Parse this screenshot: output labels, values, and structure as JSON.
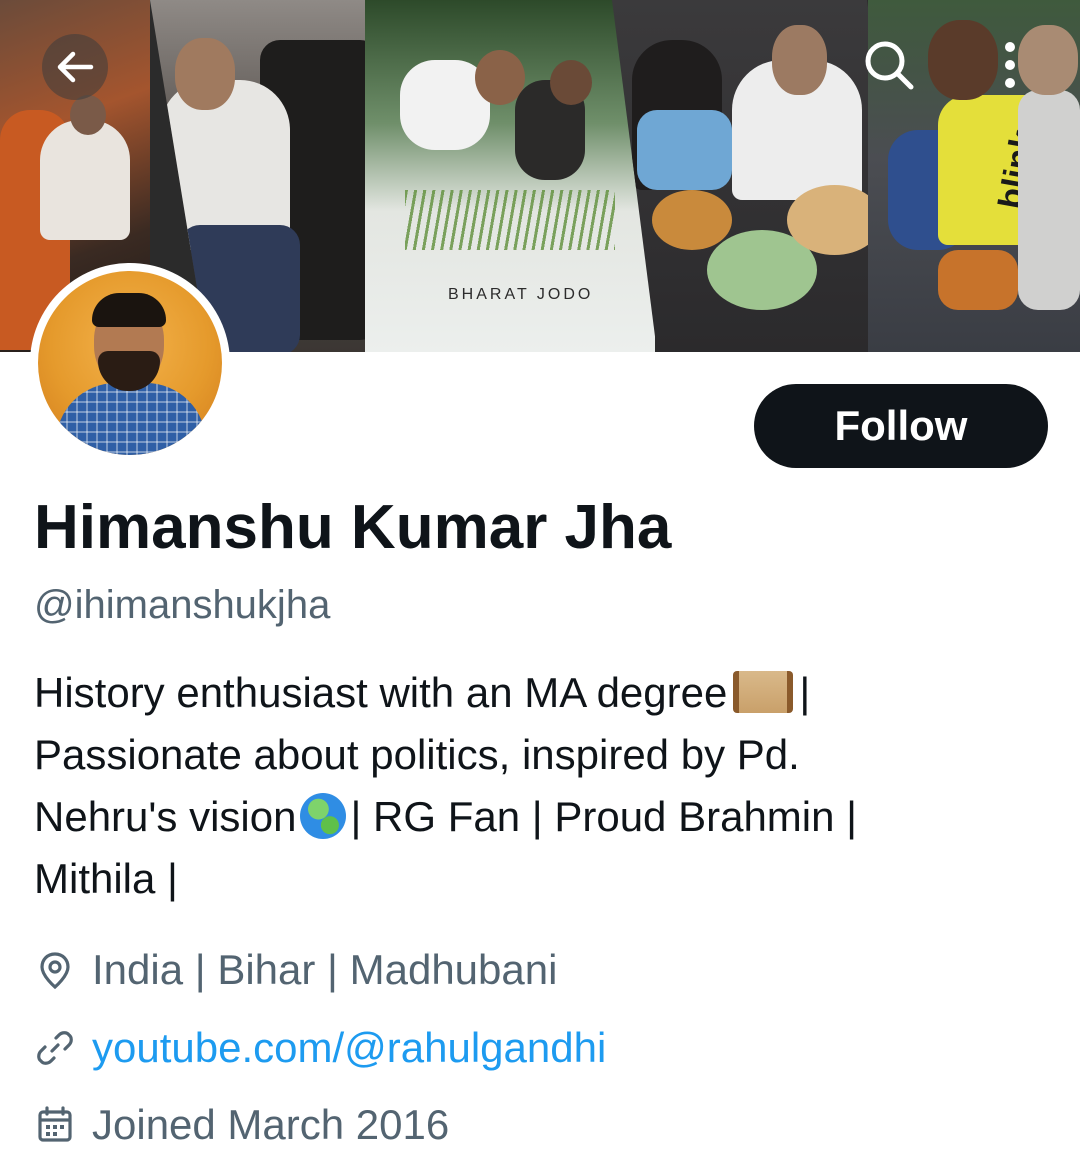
{
  "banner": {
    "caption": "BHARAT JODO",
    "vest_text": "blink"
  },
  "topbar": {
    "back_icon": "arrow-left-icon",
    "search_icon": "search-icon",
    "more_icon": "more-vertical-icon"
  },
  "profile": {
    "display_name": "Himanshu Kumar Jha",
    "handle": "@ihimanshukjha",
    "follow_label": "Follow",
    "bio_lines": [
      {
        "before": "History enthusiast with an MA degree",
        "after": "|"
      },
      {
        "text": "Passionate about politics, inspired by Pd."
      },
      {
        "before": "Nehru's vision",
        "after": "| RG Fan | Proud Brahmin |"
      },
      {
        "text": "Mithila |"
      }
    ],
    "location": "India | Bihar | Madhubani",
    "website": "youtube.com/@rahulgandhi",
    "joined": "Joined March 2016"
  },
  "colors": {
    "text_primary": "#0f1419",
    "text_secondary": "#536471",
    "link": "#1d9bf0",
    "follow_bg": "#0f1419",
    "follow_text": "#ffffff"
  }
}
